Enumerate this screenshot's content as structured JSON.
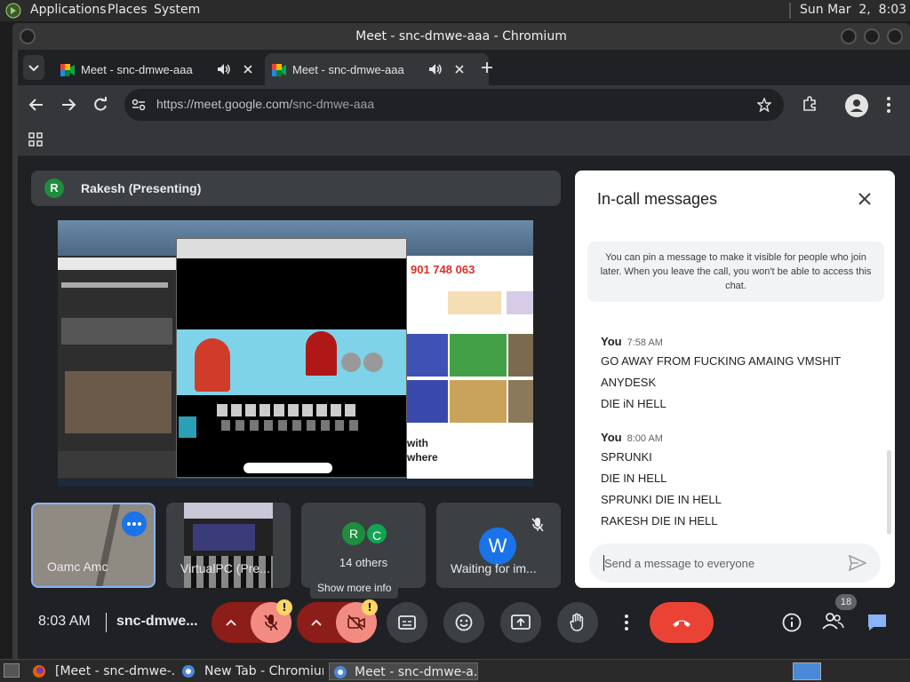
{
  "system_panel": {
    "menus": [
      "Applications",
      "Places",
      "System"
    ],
    "clock": "Sun Mar  2,  8:03 AM"
  },
  "window": {
    "title": "Meet - snc-dmwe-aaa - Chromium"
  },
  "browser": {
    "tabs": [
      {
        "label": "Meet - snc-dmwe-aaa",
        "active": false
      },
      {
        "label": "Meet - snc-dmwe-aaa",
        "active": true
      }
    ],
    "url_host": "https://meet.google.com/",
    "url_path": "snc-dmwe-aaa"
  },
  "meet": {
    "presenter": {
      "initial": "R",
      "label": "Rakesh (Presenting)"
    },
    "shared_screen": {
      "phone": "901 748 063",
      "partial_text_1": "with",
      "partial_text_2": "where"
    },
    "tiles": [
      {
        "name": "Oamc Amc"
      },
      {
        "name": "VirtualPC (Pre..."
      },
      {
        "initials": [
          "R",
          "C"
        ],
        "name": "14 others"
      },
      {
        "initial": "W",
        "name": "Waiting for im..."
      }
    ],
    "tooltip": "Show more info",
    "meeting_time": "8:03 AM",
    "meeting_code": "snc-dmwe...",
    "participants_count": "18"
  },
  "chat": {
    "title": "In-call messages",
    "notice": "You can pin a message to make it visible for people who join later. When you leave the call, you won't be able to access this chat.",
    "groups": [
      {
        "sender": "You",
        "time": "7:58 AM",
        "messages": [
          "GO AWAY FROM FUCKING AMAING VMSHIT",
          "ANYDESK",
          "DIE iN HELL"
        ]
      },
      {
        "sender": "You",
        "time": "8:00 AM",
        "messages": [
          "SPRUNKI",
          "DIE IN HELL",
          "SPRUNKI DIE IN HELL",
          "RAKESH DIE IN HELL"
        ]
      }
    ],
    "input_placeholder": "Send a message to everyone"
  },
  "taskbar": {
    "items": [
      "[Meet - snc-dmwe-...",
      "New Tab - Chromium",
      "Meet - snc-dmwe-a..."
    ]
  },
  "colors": {
    "meet_bg": "#202124",
    "danger_red": "#ea4335",
    "muted_red": "#f28b82",
    "accent_blue": "#8ab4f8",
    "warning_yellow": "#fdd663"
  }
}
